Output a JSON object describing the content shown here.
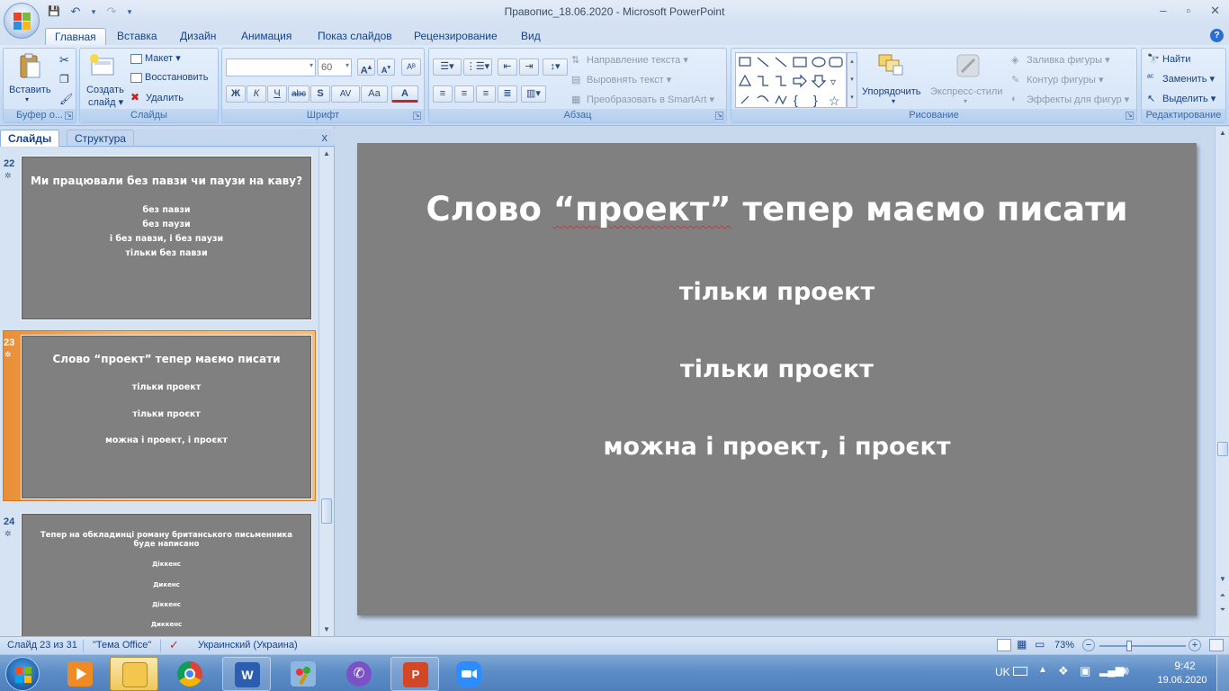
{
  "window": {
    "title": "Правопис_18.06.2020 - Microsoft PowerPoint",
    "min_glyph": "–",
    "max_glyph": "▫",
    "close_glyph": "✕"
  },
  "qat": {
    "save": "💾",
    "undo": "↶",
    "redo": "↷",
    "customize": "▾"
  },
  "ribbon_tabs": [
    "Главная",
    "Вставка",
    "Дизайн",
    "Анимация",
    "Показ слайдов",
    "Рецензирование",
    "Вид"
  ],
  "help": "?",
  "clipboard": {
    "paste": "Вставить",
    "label": "Буфер о..."
  },
  "slides_group": {
    "create": "Создать",
    "create2": "слайд",
    "layout": "Макет",
    "reset": "Восстановить",
    "delete": "Удалить",
    "label": "Слайды"
  },
  "font": {
    "name": "",
    "size": "60",
    "grow": "A",
    "shrink": "A",
    "clear": "Aᴮ",
    "bold": "Ж",
    "italic": "К",
    "underline": "Ч",
    "strike": "abc",
    "shadow": "S",
    "spacing": "AV",
    "case": "Aa",
    "color": "A",
    "label": "Шрифт"
  },
  "paragraph": {
    "direction": "Направление текста",
    "align": "Выровнять текст",
    "smartart": "Преобразовать в SmartArt",
    "label": "Абзац"
  },
  "drawing": {
    "arrange": "Упорядочить",
    "quickstyles": "Экспресс-стили",
    "fill": "Заливка фигуры",
    "outline": "Контур фигуры",
    "effects": "Эффекты для фигур",
    "label": "Рисование"
  },
  "editing": {
    "find": "Найти",
    "replace": "Заменить",
    "select": "Выделить",
    "label": "Редактирование"
  },
  "pane": {
    "tab_slides": "Слайды",
    "tab_outline": "Структура",
    "close": "x"
  },
  "thumbnails": [
    {
      "num": "22",
      "star": "✲",
      "title": "Ми працювали без павзи чи паузи на каву?",
      "lines": [
        "без павзи",
        "без паузи",
        "і без павзи, і без  паузи",
        "тільки без павзи"
      ]
    },
    {
      "num": "23",
      "star": "✲",
      "title": "Слово “проект” тепер маємо писати",
      "lines": [
        "тільки проект",
        "тільки проєкт",
        "можна і проект, і проєкт"
      ]
    },
    {
      "num": "24",
      "star": "✲",
      "title": "Тепер на обкладинці  роману британського  письменника буде написано",
      "lines": [
        "Діккенс",
        "Дикенс",
        "Діккенс",
        "Диккенс"
      ]
    }
  ],
  "slide": {
    "title_pre": "Слово ",
    "title_word": "“проект”",
    "title_post": " тепер маємо писати",
    "line1": "тільки проект",
    "line2": "тільки проєкт",
    "line3": "можна і проект, і проєкт"
  },
  "status": {
    "slide": "Слайд 23 из 31",
    "theme": "\"Тема Office\"",
    "language": "Украинский (Украина)",
    "zoom": "73%",
    "zoom_out": "−",
    "zoom_in": "+"
  },
  "taskbar": {
    "lang": "UK",
    "time": "9:42",
    "date": "19.06.2020"
  },
  "colors": {
    "slide_bg": "#808080",
    "accent_selected": "#f0a050",
    "ribbon_bg": "#d2e3f7"
  }
}
